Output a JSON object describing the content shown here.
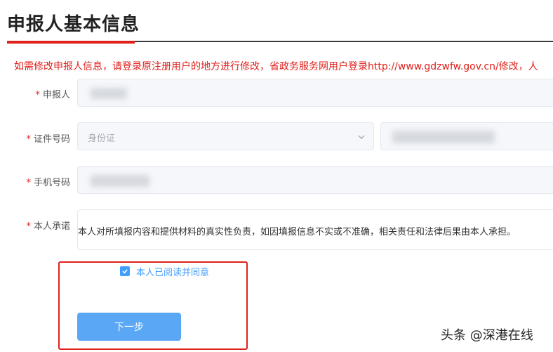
{
  "page": {
    "title": "申报人基本信息"
  },
  "notice": "如需修改申报人信息，请登录原注册用户的地方进行修改，省政务服务网用户登录http://www.gdzwfw.gov.cn/修改，人",
  "form": {
    "required_mark": "*",
    "applicant": {
      "label": "申报人"
    },
    "id_number": {
      "label": "证件号码",
      "id_type_value": "身份证"
    },
    "phone": {
      "label": "手机号码"
    },
    "promise": {
      "label": "本人承诺",
      "text": "本人对所填报内容和提供材料的真实性负责，如因填报信息不实或不准确，相关责任和法律后果由本人承担。"
    },
    "agree_checkbox": {
      "label": "本人已阅读并同意",
      "checked": true
    },
    "next_button": {
      "label": "下一步"
    }
  },
  "watermark": "头条 @深港在线",
  "colors": {
    "accent": "#409eff",
    "required": "#e0201c",
    "button": "#5aa8f5"
  },
  "icons": {
    "select_arrow": "chevron-down-icon",
    "check": "check-icon"
  }
}
